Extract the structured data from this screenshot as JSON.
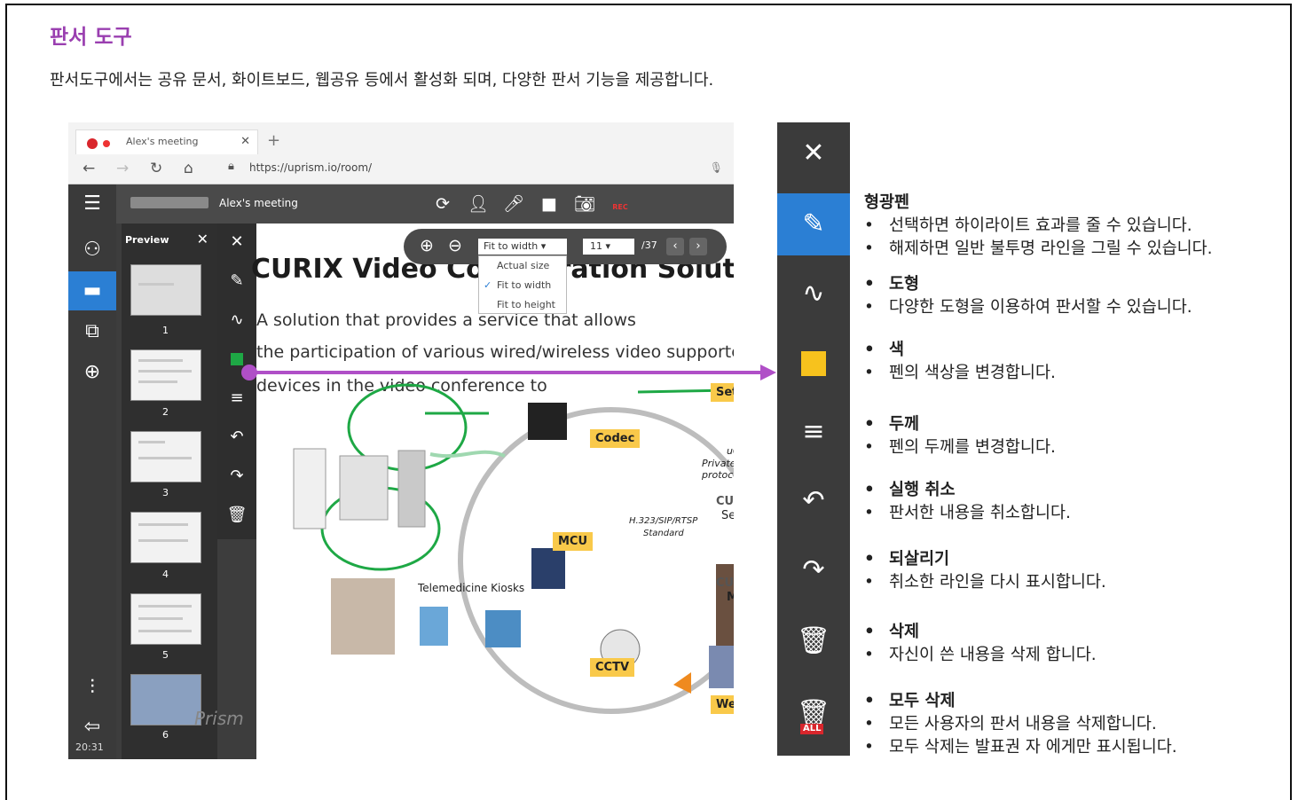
{
  "doc": {
    "title": "판서 도구",
    "description": "판서도구에서는 공유 문서, 화이트보드, 웹공유 등에서 활성화 되며, 다양한 판서 기능을 제공합니다."
  },
  "browser": {
    "tab_title": "Alex's meeting",
    "url": "https://uprism.io/room/"
  },
  "app": {
    "meeting_label": "Alex's meeting",
    "rec_label": "REC",
    "time": "20:31",
    "preview_title": "Preview",
    "thumb_numbers": [
      "1",
      "2",
      "3",
      "4",
      "5",
      "6"
    ],
    "brand": "Prism"
  },
  "viewer": {
    "fit_value": "Fit to width",
    "fit_options": [
      "Actual size",
      "Fit to width",
      "Fit to height"
    ],
    "page_value": "11",
    "page_total": "/37"
  },
  "slide": {
    "title": "CURIX Video Collaboration Solution & Plat",
    "lines": [
      "A solution that provides a service that allows",
      "the participation of various wired/wireless video supported",
      "devices in the video conference to"
    ],
    "labels": {
      "setting": "Setting",
      "codec": "Codec",
      "mcu": "MCU",
      "cctv": "CCTV",
      "webrtc": "WebRTC",
      "ucp": "uCP",
      "private_protocol": "Private protocol",
      "h323": "H.323/SIP/RTSP",
      "standard": "Standard",
      "curix_server_brand": "CURIX",
      "server": "Server",
      "curix_mcu_brand": "CURIX",
      "mcu_plain": "MCU",
      "telemedicine": "Telemedicine Kiosks"
    }
  },
  "tools": {
    "highlighter": {
      "title": "형광펜",
      "lines": [
        "선택하면 하이라이트 효과를 줄 수 있습니다.",
        "해제하면 일반 불투명 라인을 그릴 수 있습니다."
      ]
    },
    "shape": {
      "title": "도형",
      "lines": [
        "다양한 도형을 이용하여 판서할 수 있습니다."
      ]
    },
    "color": {
      "title": "색",
      "lines": [
        "펜의 색상을 변경합니다."
      ]
    },
    "thickness": {
      "title": "두께",
      "lines": [
        "펜의 두께를 변경합니다."
      ]
    },
    "undo": {
      "title": "실행 취소",
      "lines": [
        "판서한 내용을 취소합니다."
      ]
    },
    "redo": {
      "title": "되살리기",
      "lines": [
        "취소한 라인을 다시 표시합니다."
      ]
    },
    "delete": {
      "title": "삭제",
      "lines": [
        "자신이 쓴 내용을 삭제 합니다."
      ]
    },
    "delete_all": {
      "title": "모두 삭제",
      "lines": [
        "모든 사용자의 판서 내용을 삭제합니다.",
        "모두 삭제는 발표권 자 에게만 표시됩니다."
      ]
    },
    "all_badge": "ALL"
  },
  "colors": {
    "title": "#9a3fb0",
    "accent": "#2b7fd4",
    "arrow": "#b04fc7",
    "pen_color": "#f7c21d"
  }
}
